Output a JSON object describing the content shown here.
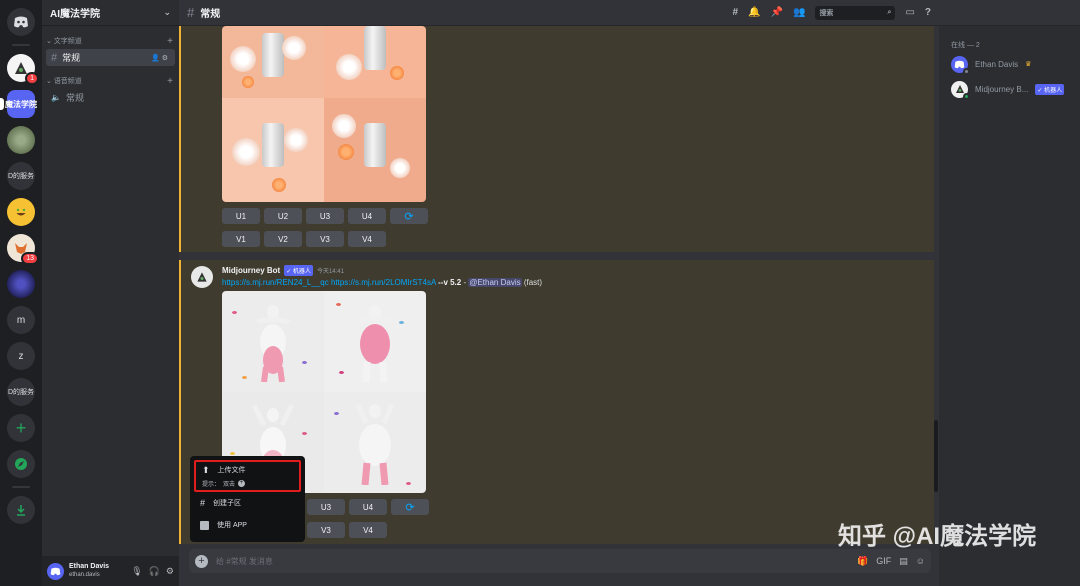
{
  "rail": {
    "active_label": "魔法学院",
    "badge_1": "1",
    "badge_13": "13",
    "server_txt_1": "D的服务",
    "server_m": "m",
    "server_z": "z",
    "server_txt_2": "D的服务"
  },
  "sidebar": {
    "guild_name": "AI魔法学院",
    "text_category": "文字频道",
    "text_channel": "常规",
    "voice_category": "语音频道",
    "voice_channel": "常规",
    "user_name": "Ethan Davis",
    "user_tag": "ethan.davis"
  },
  "topbar": {
    "channel_name": "常规",
    "search_placeholder": "搜索"
  },
  "messages": {
    "row1_buttons": [
      "U1",
      "U2",
      "U3",
      "U4"
    ],
    "row2_buttons": [
      "V1",
      "V2",
      "V3",
      "V4"
    ],
    "bot_name": "Midjourney Bot",
    "bot_tag": "机器人",
    "time": "今天14:41",
    "link1": "https://s.mj.run/REN24_L__qc",
    "link2": "https://s.mj.run/2LOMIrST4sA",
    "param": "--v 5.2",
    "dash": " - ",
    "mention": "@Ethan Davis",
    "speed": "(fast)",
    "row3_buttons": [
      "U3",
      "U4"
    ],
    "row4_buttons": [
      "V3",
      "V4"
    ]
  },
  "popup": {
    "upload": "上传文件",
    "hint_label": "提示：",
    "hint_action": "双击",
    "thread": "创建子区",
    "app": "使用 APP"
  },
  "composer": {
    "placeholder": "给 #常规 发消息"
  },
  "members": {
    "heading": "在线 — 2",
    "member1": "Ethan Davis",
    "member2": "Midjourney B...",
    "member2_tag": "机器人"
  },
  "watermark": "知乎 @AI魔法学院",
  "colors": {
    "accent": "#5865f2",
    "highlight_border": "#f0b232",
    "link": "#00a8fc",
    "popup_outline": "#e11d1d"
  }
}
